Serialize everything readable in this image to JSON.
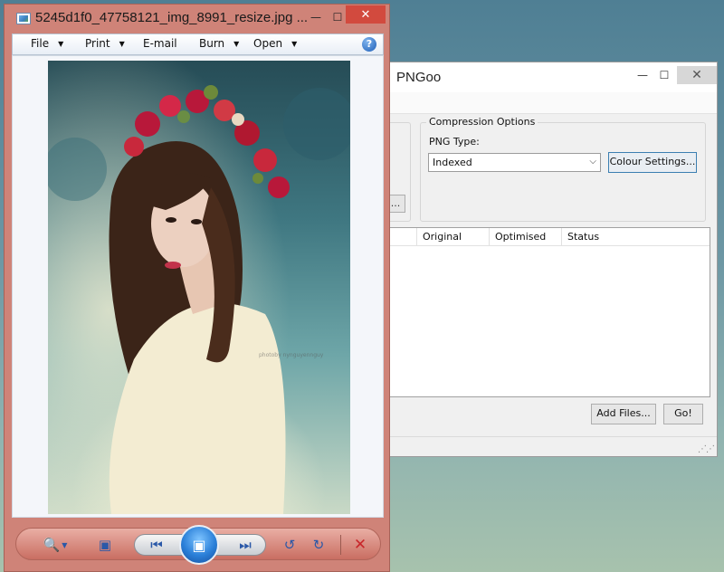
{
  "pngoo": {
    "title": "PNGoo",
    "window_controls": {
      "minimize": "—",
      "maximize": "☐",
      "close": "✕"
    },
    "ellipsis_button": "...",
    "compression": {
      "group_label": "Compression Options",
      "png_type_label": "PNG Type:",
      "png_type_value": "Indexed",
      "colour_settings_button": "Colour Settings..."
    },
    "file_list": {
      "columns": [
        "Original",
        "Optimised",
        "Status"
      ]
    },
    "add_files_button": "Add Files...",
    "go_button": "Go!"
  },
  "viewer": {
    "title": "5245d1f0_47758121_img_8991_resize.jpg ...",
    "window_controls": {
      "minimize": "—",
      "maximize": "☐",
      "close": "✕"
    },
    "menu": {
      "file": "File",
      "print": "Print",
      "email": "E-mail",
      "burn": "Burn",
      "open": "Open",
      "help": "?"
    },
    "photo_watermark": "photoby nynguyennguy",
    "controls": {
      "zoom_icon": "zoom-icon",
      "fit_icon": "actual-size-icon",
      "previous_icon": "previous-icon",
      "slideshow_icon": "slideshow-icon",
      "next_icon": "next-icon",
      "rotate_ccw_icon": "rotate-counterclockwise-icon",
      "rotate_cw_icon": "rotate-clockwise-icon",
      "delete_icon": "delete-icon"
    }
  },
  "colors": {
    "viewer_frame": "#cf8378",
    "close_red": "#d24a3e",
    "accent_blue": "#2a7fd8"
  }
}
